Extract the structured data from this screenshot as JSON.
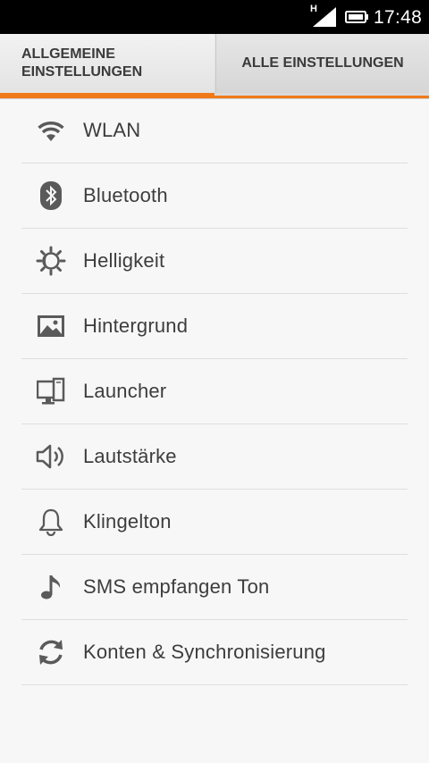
{
  "status_bar": {
    "network_type": "H",
    "time": "17:48"
  },
  "tabs": {
    "general": "ALLGEMEINE\nEINSTELLUNGEN",
    "all": "ALLE EINSTELLUNGEN"
  },
  "items": [
    {
      "label": "WLAN",
      "icon": "wifi-icon"
    },
    {
      "label": "Bluetooth",
      "icon": "bluetooth-icon"
    },
    {
      "label": "Helligkeit",
      "icon": "brightness-icon"
    },
    {
      "label": "Hintergrund",
      "icon": "wallpaper-icon"
    },
    {
      "label": "Launcher",
      "icon": "launcher-icon"
    },
    {
      "label": "Lautstärke",
      "icon": "volume-icon"
    },
    {
      "label": "Klingelton",
      "icon": "bell-icon"
    },
    {
      "label": "SMS empfangen Ton",
      "icon": "music-note-icon"
    },
    {
      "label": "Konten & Synchronisierung",
      "icon": "sync-icon"
    }
  ],
  "colors": {
    "accent": "#f07a1a",
    "text": "#3d3d3d",
    "icon": "#5a5a5a",
    "background": "#f7f7f7"
  }
}
